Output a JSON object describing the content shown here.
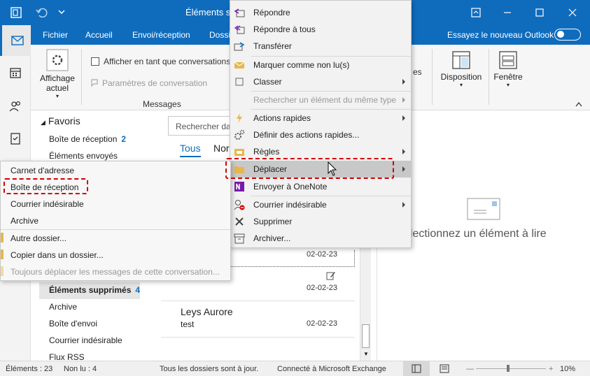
{
  "titlebar": {
    "title": "Éléments su",
    "app_icon": "outlook-app-icon",
    "undo_icon": "undo-icon"
  },
  "ribbon_tabs": [
    "Fichier",
    "Accueil",
    "Envoi/réception",
    "Dossi"
  ],
  "try_new": "Essayez le nouveau Outlook",
  "ribbon": {
    "view_button": [
      "Affichage",
      "actuel"
    ],
    "conv_checkbox": "Afficher en tant que conversations",
    "conv_settings": "Paramètres de conversation",
    "group_label": "Messages",
    "frag_right": "es",
    "disposition": "Disposition",
    "fenetre": "Fenêtre"
  },
  "folders": {
    "favoris": "Favoris",
    "inbox": "Boîte de réception",
    "inbox_count": "2",
    "sent": "Éléments envoyés",
    "deleted": "Éléments supprimés",
    "deleted_count": "4",
    "archive": "Archive",
    "outbox": "Boîte d'envoi",
    "junk": "Courrier indésirable",
    "rss": "Flux RSS"
  },
  "maillist": {
    "search_placeholder": "Rechercher dan",
    "filter_all": "Tous",
    "filter_unread": "Nor",
    "dates": [
      "02-02-23",
      "02-02-23"
    ],
    "message": {
      "sender": "Leys Aurore",
      "subject": "test",
      "date": "02-02-23"
    }
  },
  "reading_pane": {
    "text": "électionnez un élément à lire"
  },
  "status": {
    "items": "Éléments : 23",
    "unread": "Non lu : 4",
    "sync": "Tous les dossiers sont à jour.",
    "connection": "Connecté à Microsoft Exchange",
    "zoom": "10%"
  },
  "context_menu": {
    "items": [
      {
        "label": "Répondre"
      },
      {
        "label": "Répondre à tous"
      },
      {
        "label": "Transférer"
      },
      {
        "label": "Marquer comme non lu(s)"
      },
      {
        "label": "Classer"
      },
      {
        "label": "Rechercher un élément du même type"
      },
      {
        "label": "Actions rapides"
      },
      {
        "label": "Définir des actions rapides..."
      },
      {
        "label": "Règles"
      },
      {
        "label": "Déplacer"
      },
      {
        "label": "Envoyer à OneNote"
      },
      {
        "label": "Courrier indésirable"
      },
      {
        "label": "Supprimer"
      },
      {
        "label": "Archiver..."
      }
    ]
  },
  "submenu": {
    "items": [
      {
        "label": "Carnet d'adresse"
      },
      {
        "label": "Boîte de réception"
      },
      {
        "label": "Courrier indésirable"
      },
      {
        "label": "Archive"
      },
      {
        "label": "Autre dossier..."
      },
      {
        "label": "Copier dans un dossier..."
      },
      {
        "label": "Toujours déplacer les messages de cette conversation..."
      }
    ]
  },
  "colors": {
    "brand": "#0f6cbd",
    "highlight_box": "#d10000",
    "onenote": "#7719aa"
  }
}
